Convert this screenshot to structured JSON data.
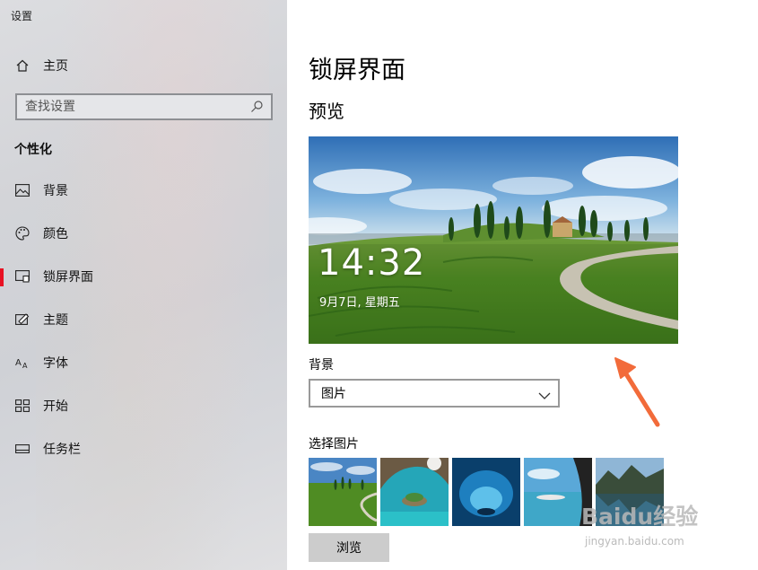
{
  "window": {
    "title": "设置"
  },
  "sidebar": {
    "home_label": "主页",
    "search": {
      "placeholder": "查找设置"
    },
    "section_title": "个性化",
    "items": [
      {
        "label": "背景",
        "icon": "image-icon"
      },
      {
        "label": "颜色",
        "icon": "palette-icon"
      },
      {
        "label": "锁屏界面",
        "icon": "lock-screen-icon",
        "active": true
      },
      {
        "label": "主题",
        "icon": "theme-icon"
      },
      {
        "label": "字体",
        "icon": "font-icon"
      },
      {
        "label": "开始",
        "icon": "start-icon"
      },
      {
        "label": "任务栏",
        "icon": "taskbar-icon"
      }
    ]
  },
  "main": {
    "title": "锁屏界面",
    "preview_heading": "预览",
    "lock_preview": {
      "time": "14:32",
      "date": "9月7日, 星期五"
    },
    "background": {
      "label": "背景",
      "selected": "图片"
    },
    "choose_picture_label": "选择图片",
    "browse_label": "浏览"
  },
  "colors": {
    "accent": "#e81123",
    "annotation_arrow": "#f26b3a"
  },
  "watermark": {
    "logo": "Baidu经验",
    "url": "jingyan.baidu.com"
  }
}
